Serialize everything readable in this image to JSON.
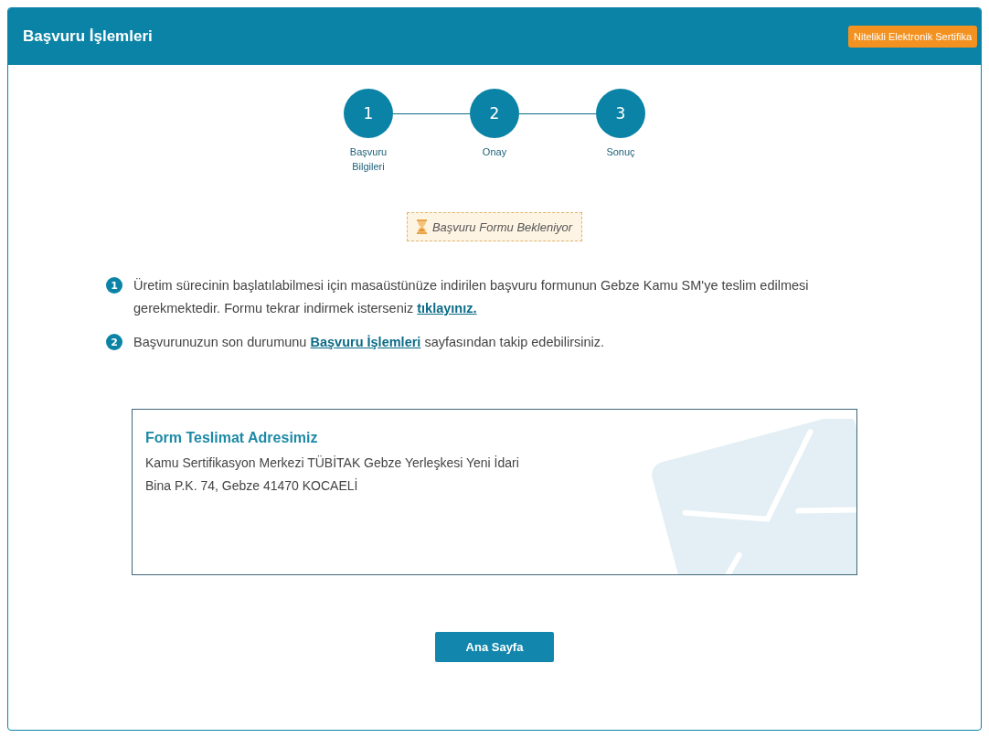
{
  "header": {
    "title": "Başvuru İşlemleri",
    "action_button": "Nitelikli Elektronik Sertifika"
  },
  "steps": [
    {
      "number": "1",
      "label": "Başvuru Bilgileri",
      "completed": true
    },
    {
      "number": "2",
      "label": "Onay",
      "completed": true
    },
    {
      "number": "3",
      "label": "Sonuç",
      "completed": true
    }
  ],
  "status_badge": {
    "label": "Başvuru Formu Bekleniyor"
  },
  "instructions": [
    {
      "number": "1",
      "before": "Üretim sürecinin başlatılabilmesi için masaüstünüze indirilen başvuru formunun Gebze Kamu SM'ye teslim edilmesi gerekmektedir. Formu tekrar indirmek isterseniz ",
      "link": "tıklayınız."
    },
    {
      "number": "2",
      "before": "Başvurunuzun son durumunu ",
      "link": "Başvuru İşlemleri",
      "after": " sayfasından takip edebilirsiniz."
    }
  ],
  "address_card": {
    "title": "Form Teslimat Adresimiz",
    "lines": [
      "Kamu Sertifikasyon Merkezi TÜBİTAK Gebze Yerleşkesi Yeni İdari",
      "Bina P.K. 74, Gebze 41470 KOCAELİ"
    ]
  },
  "home_button": "Ana Sayfa"
}
